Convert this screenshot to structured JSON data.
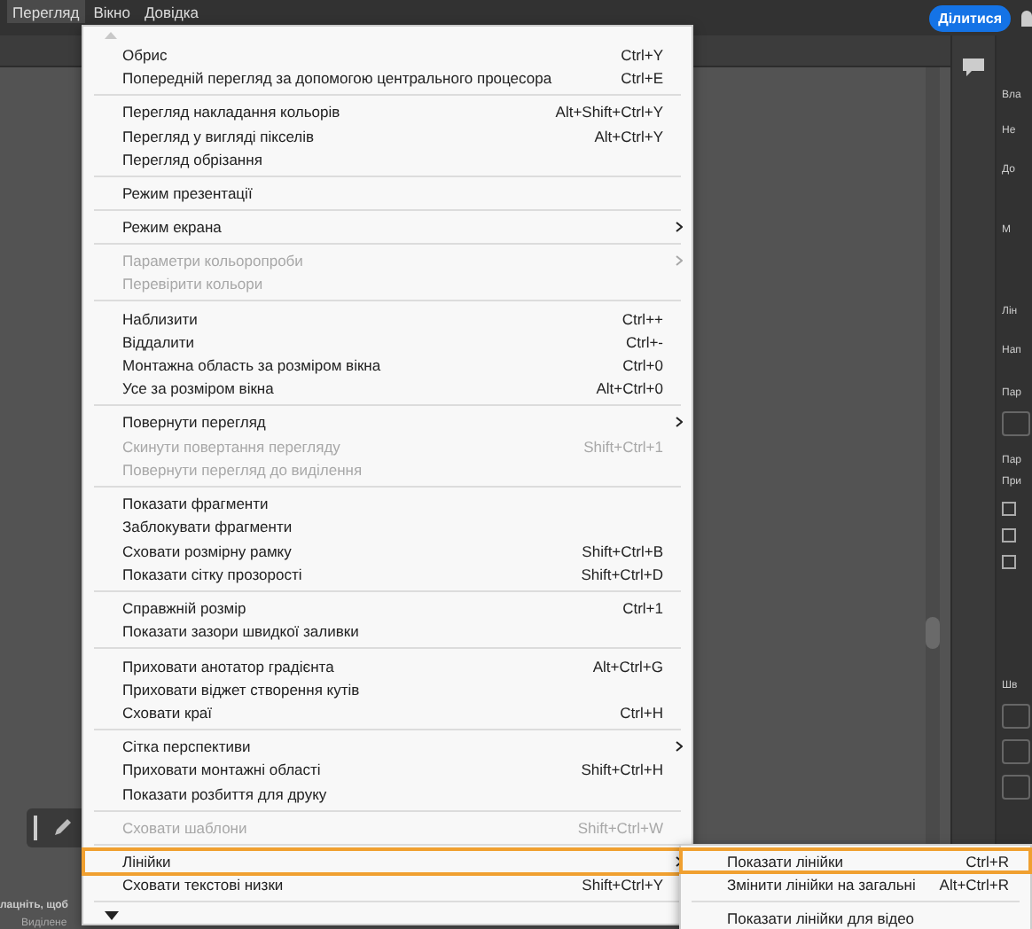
{
  "menubar": [
    {
      "label": "Перегляд",
      "selected": true
    },
    {
      "label": "Вікно",
      "selected": false
    },
    {
      "label": "Довідка",
      "selected": false
    }
  ],
  "share_button": "Ділитися",
  "right_panel": {
    "labels": [
      "Вла",
      "Не",
      "До",
      "М",
      "Лін",
      "Нап",
      "Пар",
      "Пар",
      "При",
      "Шв"
    ],
    "checkboxes": [
      {
        "checked": false
      },
      {
        "checked": false
      },
      {
        "checked": false
      }
    ]
  },
  "status": {
    "hint": "лацніть, щоб",
    "selection": "Виділене"
  },
  "menu": [
    {
      "kind": "item",
      "label": "Обрис",
      "shortcut": "Ctrl+Y",
      "submenu": false,
      "disabled": false,
      "selected": false
    },
    {
      "kind": "item",
      "label": "Попередній перегляд за допомогою центрального процесора",
      "shortcut": "Ctrl+E",
      "submenu": false,
      "disabled": false,
      "selected": false
    },
    {
      "kind": "separator"
    },
    {
      "kind": "item",
      "label": "Перегляд накладання кольорів",
      "shortcut": "Alt+Shift+Ctrl+Y",
      "submenu": false,
      "disabled": false,
      "selected": false
    },
    {
      "kind": "item",
      "label": "Перегляд у вигляді пікселів",
      "shortcut": "Alt+Ctrl+Y",
      "submenu": false,
      "disabled": false,
      "selected": false
    },
    {
      "kind": "item",
      "label": "Перегляд обрізання",
      "submenu": false,
      "disabled": false,
      "selected": false
    },
    {
      "kind": "separator"
    },
    {
      "kind": "item",
      "label": "Режим презентації",
      "submenu": false,
      "disabled": false,
      "selected": false
    },
    {
      "kind": "separator"
    },
    {
      "kind": "item",
      "label": "Режим екрана",
      "submenu": true,
      "disabled": false,
      "selected": false
    },
    {
      "kind": "separator"
    },
    {
      "kind": "item",
      "label": "Параметри кольоропроби",
      "submenu": true,
      "disabled": true,
      "selected": false
    },
    {
      "kind": "item",
      "label": "Перевірити кольори",
      "submenu": false,
      "disabled": true,
      "selected": false
    },
    {
      "kind": "separator"
    },
    {
      "kind": "item",
      "label": "Наблизити",
      "shortcut": "Ctrl++",
      "submenu": false,
      "disabled": false,
      "selected": false
    },
    {
      "kind": "item",
      "label": "Віддалити",
      "shortcut": "Ctrl+-",
      "submenu": false,
      "disabled": false,
      "selected": false
    },
    {
      "kind": "item",
      "label": "Монтажна область за розміром вікна",
      "shortcut": "Ctrl+0",
      "submenu": false,
      "disabled": false,
      "selected": false
    },
    {
      "kind": "item",
      "label": "Усе за розміром вікна",
      "shortcut": "Alt+Ctrl+0",
      "submenu": false,
      "disabled": false,
      "selected": false
    },
    {
      "kind": "separator"
    },
    {
      "kind": "item",
      "label": "Повернути перегляд",
      "submenu": true,
      "disabled": false,
      "selected": false
    },
    {
      "kind": "item",
      "label": "Скинути повертання перегляду",
      "shortcut": "Shift+Ctrl+1",
      "submenu": false,
      "disabled": true,
      "selected": false
    },
    {
      "kind": "item",
      "label": "Повернути перегляд до виділення",
      "submenu": false,
      "disabled": true,
      "selected": false
    },
    {
      "kind": "separator"
    },
    {
      "kind": "item",
      "label": "Показати фрагменти",
      "submenu": false,
      "disabled": false,
      "selected": false
    },
    {
      "kind": "item",
      "label": "Заблокувати фрагменти",
      "submenu": false,
      "disabled": false,
      "selected": false
    },
    {
      "kind": "item",
      "label": "Сховати розмірну рамку",
      "shortcut": "Shift+Ctrl+B",
      "submenu": false,
      "disabled": false,
      "selected": false
    },
    {
      "kind": "item",
      "label": "Показати сітку прозорості",
      "shortcut": "Shift+Ctrl+D",
      "submenu": false,
      "disabled": false,
      "selected": false
    },
    {
      "kind": "separator"
    },
    {
      "kind": "item",
      "label": "Справжній розмір",
      "shortcut": "Ctrl+1",
      "submenu": false,
      "disabled": false,
      "selected": false
    },
    {
      "kind": "item",
      "label": "Показати зазори швидкої заливки",
      "submenu": false,
      "disabled": false,
      "selected": false
    },
    {
      "kind": "separator"
    },
    {
      "kind": "item",
      "label": "Приховати анотатор градієнта",
      "shortcut": "Alt+Ctrl+G",
      "submenu": false,
      "disabled": false,
      "selected": false
    },
    {
      "kind": "item",
      "label": "Приховати віджет створення кутів",
      "submenu": false,
      "disabled": false,
      "selected": false
    },
    {
      "kind": "item",
      "label": "Сховати краї",
      "shortcut": "Ctrl+H",
      "submenu": false,
      "disabled": false,
      "selected": false
    },
    {
      "kind": "separator"
    },
    {
      "kind": "item",
      "label": "Сітка перспективи",
      "submenu": true,
      "disabled": false,
      "selected": false
    },
    {
      "kind": "item",
      "label": "Приховати монтажні області",
      "shortcut": "Shift+Ctrl+H",
      "submenu": false,
      "disabled": false,
      "selected": false
    },
    {
      "kind": "item",
      "label": "Показати розбиття для друку",
      "submenu": false,
      "disabled": false,
      "selected": false
    },
    {
      "kind": "separator"
    },
    {
      "kind": "item",
      "label": "Сховати шаблони",
      "shortcut": "Shift+Ctrl+W",
      "submenu": false,
      "disabled": true,
      "selected": false
    },
    {
      "kind": "separator"
    },
    {
      "kind": "item",
      "label": "Лінійки",
      "submenu": true,
      "disabled": false,
      "selected": true
    },
    {
      "kind": "item",
      "label": "Сховати текстові низки",
      "shortcut": "Shift+Ctrl+Y",
      "submenu": false,
      "disabled": false,
      "selected": false
    },
    {
      "kind": "separator"
    }
  ],
  "submenu": [
    {
      "kind": "item",
      "label": "Показати лінійки",
      "shortcut": "Ctrl+R",
      "selected": true
    },
    {
      "kind": "item",
      "label": "Змінити лінійки на загальні",
      "shortcut": "Alt+Ctrl+R",
      "selected": false
    },
    {
      "kind": "separator"
    },
    {
      "kind": "item",
      "label": "Показати лінійки для відео",
      "selected": false
    }
  ]
}
